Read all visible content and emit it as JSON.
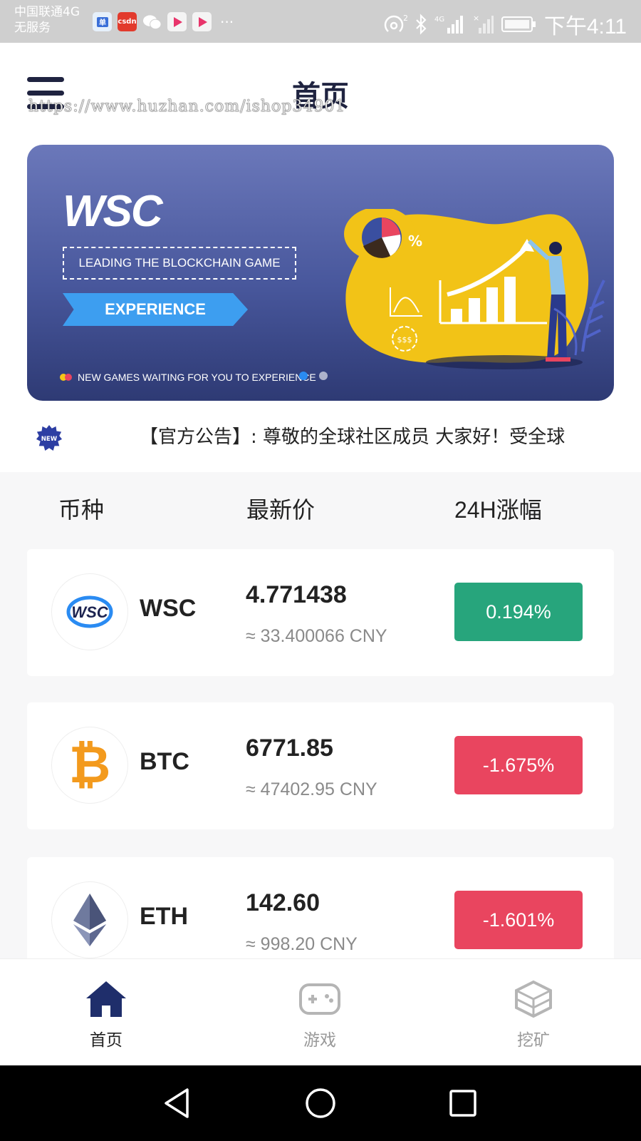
{
  "status_bar": {
    "carrier_line1": "中国联通4G",
    "carrier_line2": "无服务",
    "apps": [
      {
        "name": "jingdong-icon",
        "label": "",
        "color": "#e6f0fb"
      },
      {
        "name": "csdn-icon",
        "label": "csdn",
        "color": "#e23a2c"
      },
      {
        "name": "wechat-icon",
        "label": "",
        "color": "#cfcfcf"
      },
      {
        "name": "youku-icon",
        "label": "",
        "color": "#f2f2f2"
      },
      {
        "name": "youku-icon",
        "label": "",
        "color": "#f2f2f2"
      }
    ],
    "more": "···",
    "time": "下午4:11"
  },
  "header": {
    "title": "首页",
    "watermark": "https://www.huzhan.com/ishop34901"
  },
  "banner": {
    "logo": "WSC",
    "lead_text": "LEADING THE BLOCKCHAIN GAME",
    "experience": "EXPERIENCE",
    "subtitle": "NEW GAMES WAITING FOR YOU TO EXPERIENCE",
    "active_slide": 1,
    "slide_count": 2
  },
  "notice": {
    "badge": "NEW",
    "text": "【官方公告】: 尊敬的全球社区成员 大家好！受全球"
  },
  "table": {
    "col_coin": "币种",
    "col_price": "最新价",
    "col_change": "24H涨幅"
  },
  "coins": [
    {
      "symbol": "WSC",
      "price": "4.771438",
      "cny": "≈ 33.400066 CNY",
      "change": "0.194%",
      "direction": "up"
    },
    {
      "symbol": "BTC",
      "price": "6771.85",
      "cny": "≈ 47402.95 CNY",
      "change": "-1.675%",
      "direction": "down"
    },
    {
      "symbol": "ETH",
      "price": "142.60",
      "cny": "≈ 998.20 CNY",
      "change": "-1.601%",
      "direction": "down"
    }
  ],
  "colors": {
    "up": "#27a57c",
    "down": "#e9455f",
    "navy": "#1f2e6b",
    "accent_blue": "#2a8bf2"
  },
  "bottom_nav": {
    "items": [
      {
        "label": "首页",
        "icon": "home-icon",
        "active": true
      },
      {
        "label": "游戏",
        "icon": "gamepad-icon",
        "active": false
      },
      {
        "label": "挖矿",
        "icon": "cube-icon",
        "active": false
      }
    ]
  }
}
